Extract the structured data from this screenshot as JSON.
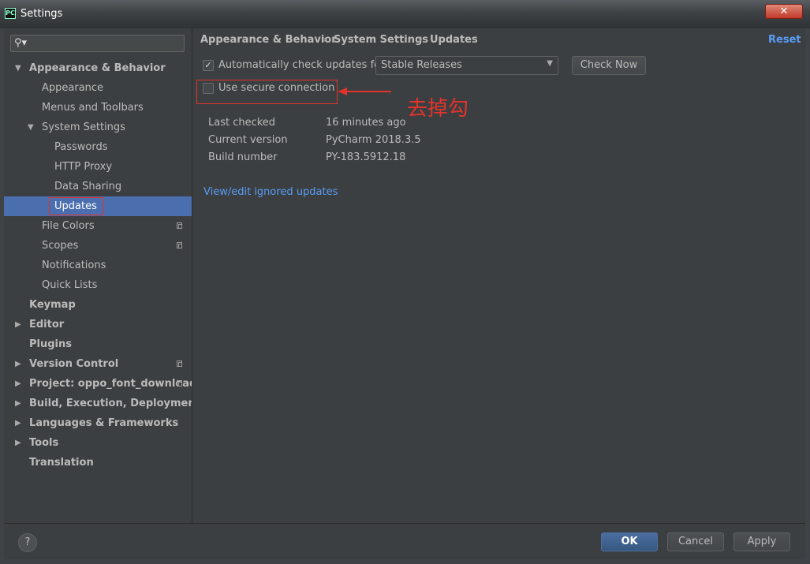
{
  "window": {
    "title": "Settings",
    "app_icon": "PC",
    "close_label": "✕"
  },
  "search": {
    "placeholder": ""
  },
  "sidebar": {
    "items": [
      {
        "label": "Appearance & Behavior",
        "arrow": "▼"
      },
      {
        "label": "Appearance"
      },
      {
        "label": "Menus and Toolbars"
      },
      {
        "label": "System Settings",
        "arrow": "▼"
      },
      {
        "label": "Passwords"
      },
      {
        "label": "HTTP Proxy"
      },
      {
        "label": "Data Sharing"
      },
      {
        "label": "Updates"
      },
      {
        "label": "File Colors"
      },
      {
        "label": "Scopes"
      },
      {
        "label": "Notifications"
      },
      {
        "label": "Quick Lists"
      },
      {
        "label": "Keymap"
      },
      {
        "label": "Editor",
        "arrow": "▶"
      },
      {
        "label": "Plugins"
      },
      {
        "label": "Version Control",
        "arrow": "▶"
      },
      {
        "label": "Project: oppo_font_download",
        "arrow": "▶"
      },
      {
        "label": "Build, Execution, Deployment",
        "arrow": "▶"
      },
      {
        "label": "Languages & Frameworks",
        "arrow": "▶"
      },
      {
        "label": "Tools",
        "arrow": "▶"
      },
      {
        "label": "Translation"
      }
    ]
  },
  "breadcrumb": {
    "items": [
      "Appearance & Behavior",
      "System Settings",
      "Updates"
    ],
    "separator": "›"
  },
  "reset_label": "Reset",
  "updates": {
    "auto_check_label": "Automatically check updates for",
    "auto_check_checked": true,
    "channel": "Stable Releases",
    "check_now_label": "Check Now",
    "secure_label": "Use secure connection",
    "secure_checked": false,
    "info": [
      {
        "key": "Last checked",
        "value": "16 minutes ago"
      },
      {
        "key": "Current version",
        "value": "PyCharm 2018.3.5"
      },
      {
        "key": "Build number",
        "value": "PY-183.5912.18"
      }
    ],
    "ignored_link": "View/edit ignored updates"
  },
  "annotation": {
    "text": "去掉勾",
    "color": "#e0342b"
  },
  "footer": {
    "help": "?",
    "ok": "OK",
    "cancel": "Cancel",
    "apply": "Apply"
  },
  "colors": {
    "accent": "#4b6eaf",
    "link": "#589df6",
    "background": "#3c3f41"
  }
}
